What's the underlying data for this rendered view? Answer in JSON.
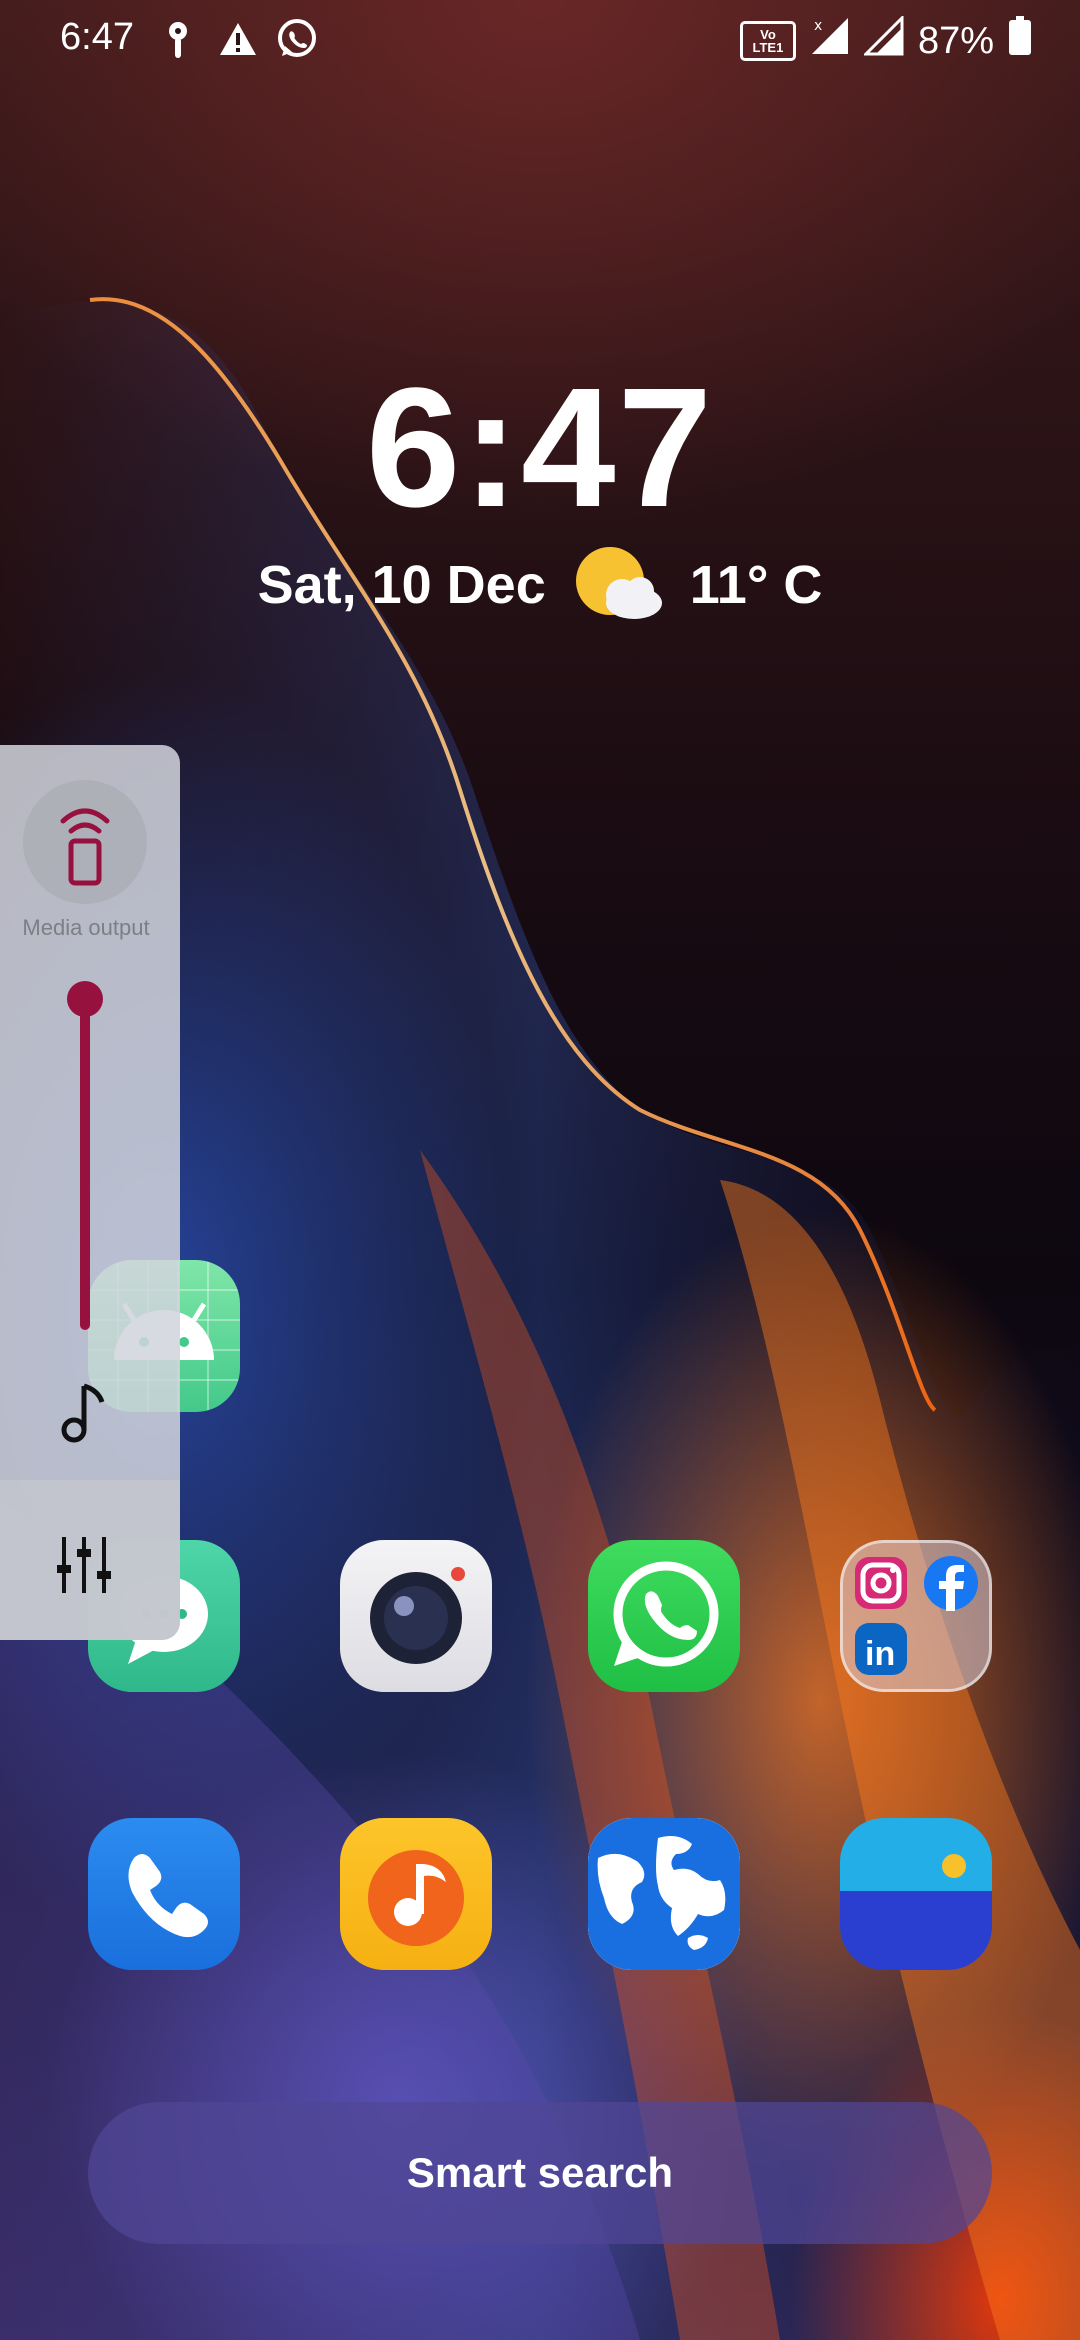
{
  "status_bar": {
    "time": "6:47",
    "network_badge": "Vo LTE1",
    "battery_percent": "87%",
    "icons": [
      "location-icon",
      "warning-icon",
      "whatsapp-icon",
      "volte-icon",
      "signal-icon",
      "signal-icon",
      "battery-icon"
    ]
  },
  "lockscreen": {
    "clock": "6:47",
    "date": "Sat, 10 Dec",
    "temperature": "11° C",
    "weather_icon": "partly-cloudy-icon"
  },
  "volume_panel": {
    "media_output_label": "Media output",
    "volume_level": 1.0,
    "accent_color": "#97113f"
  },
  "apps_row1": [
    "android-app-icon"
  ],
  "apps_row2": [
    "messages-app-icon",
    "camera-app-icon",
    "whatsapp-app-icon",
    "social-folder-icon"
  ],
  "apps_row3": [
    "phone-app-icon",
    "music-app-icon",
    "browser-app-icon",
    "gallery-app-icon"
  ],
  "search": {
    "label": "Smart search"
  }
}
